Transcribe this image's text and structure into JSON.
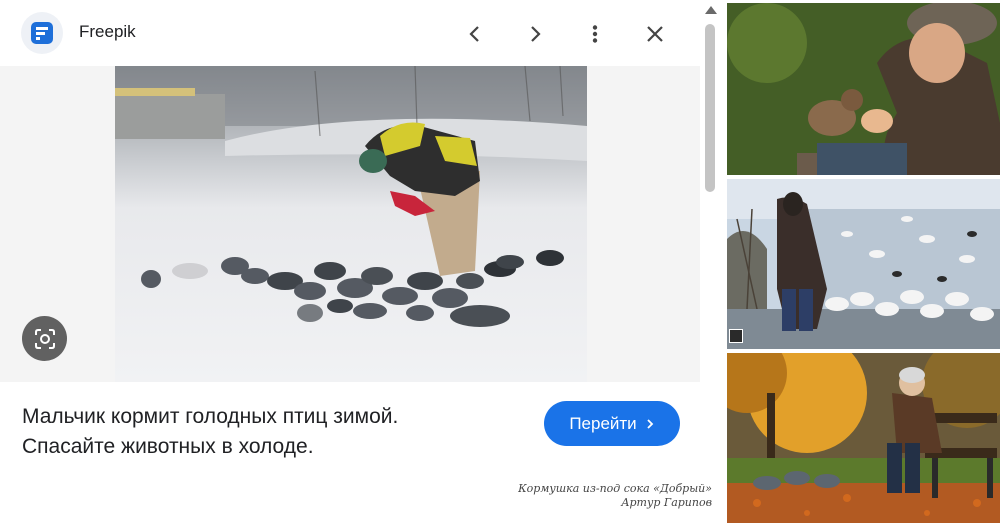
{
  "header": {
    "site_name": "Freepik",
    "icons": [
      "freepik-logo-icon",
      "chevron-left-icon",
      "chevron-right-icon",
      "more-vert-icon",
      "close-icon"
    ]
  },
  "main": {
    "caption_line1": "Мальчик кормит голодных птиц зимой.",
    "caption_line2": "Спасайте животных в холоде.",
    "visit_button": "Перейти",
    "lens_icon": "google-lens-icon"
  },
  "watermark": {
    "line1": "Кормушка из-под сока «Добрый»",
    "line2": "Артур Гарипов"
  },
  "colors": {
    "accent": "#1a73e8",
    "favicon": "#1e6fd9",
    "text": "#202124"
  }
}
